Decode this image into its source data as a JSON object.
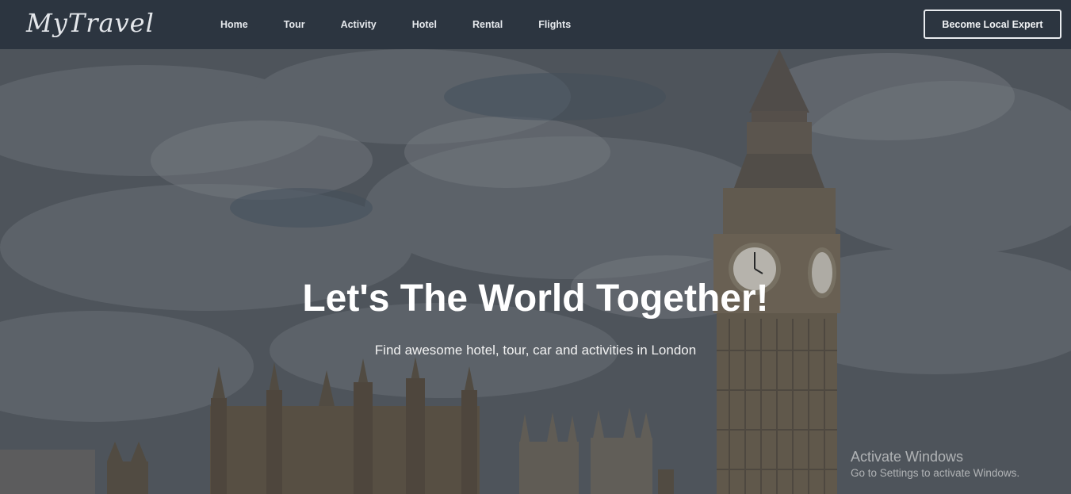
{
  "header": {
    "logo_text": "MyTravel",
    "nav": [
      {
        "label": "Home"
      },
      {
        "label": "Tour"
      },
      {
        "label": "Activity"
      },
      {
        "label": "Hotel"
      },
      {
        "label": "Rental"
      },
      {
        "label": "Flights"
      }
    ],
    "cta_label": "Become Local Expert"
  },
  "hero": {
    "title": "Let's The World Together!",
    "subtitle": "Find awesome hotel, tour, car and activities in London",
    "background": "london-big-ben-photo"
  },
  "os_watermark": {
    "title": "Activate Windows",
    "subtitle": "Go to Settings to activate Windows."
  },
  "colors": {
    "navbar": "#2c3540",
    "text": "#ffffff"
  }
}
